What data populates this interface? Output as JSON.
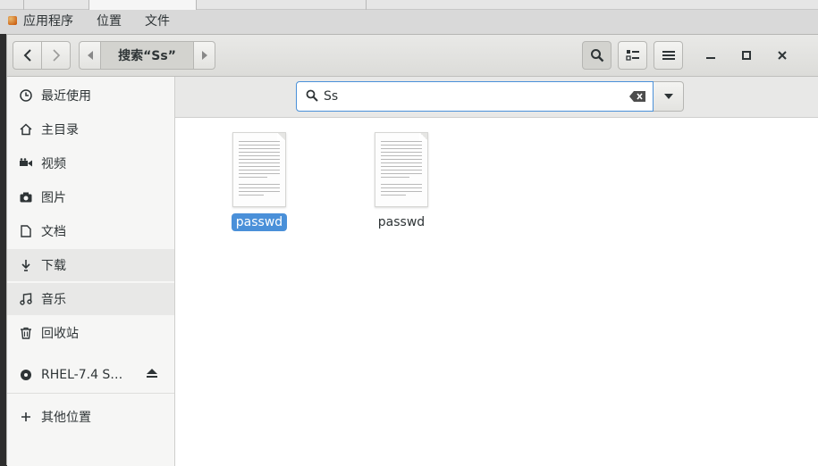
{
  "top_menu": {
    "items": [
      "应用程序",
      "位置",
      "文件"
    ]
  },
  "headerbar": {
    "search_crumb": "搜索“Ss”"
  },
  "sidebar": {
    "items": [
      {
        "label": "最近使用",
        "icon": "clock-icon"
      },
      {
        "label": "主目录",
        "icon": "home-icon"
      },
      {
        "label": "视频",
        "icon": "video-icon"
      },
      {
        "label": "图片",
        "icon": "camera-icon"
      },
      {
        "label": "文档",
        "icon": "document-icon"
      },
      {
        "label": "下载",
        "icon": "download-icon"
      },
      {
        "label": "音乐",
        "icon": "music-icon"
      },
      {
        "label": "回收站",
        "icon": "trash-icon"
      }
    ],
    "device": {
      "label": "RHEL-7.4 S…",
      "icon": "disc-icon"
    },
    "other_locations": {
      "label": "其他位置",
      "icon": "plus-icon"
    }
  },
  "search": {
    "value": "Ss"
  },
  "files": [
    {
      "name": "passwd",
      "selected": true
    },
    {
      "name": "passwd",
      "selected": false
    }
  ],
  "colors": {
    "accent": "#4a90d9",
    "sidebar_bg": "#f6f6f5"
  }
}
